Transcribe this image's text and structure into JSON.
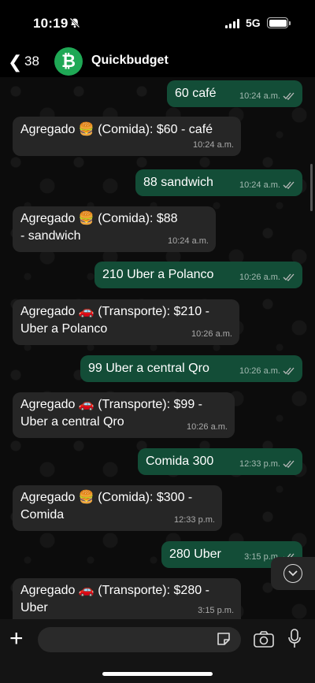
{
  "status_bar": {
    "time": "10:19",
    "network": "5G"
  },
  "header": {
    "back_count": "38",
    "contact_name": "Quickbudget",
    "avatar_letter": "₿"
  },
  "messages": [
    {
      "type": "out",
      "text": "60 café",
      "time": "10:24 a.m."
    },
    {
      "type": "in",
      "text": "Agregado 🍔 (Comida): $60 - café",
      "time": "10:24 a.m."
    },
    {
      "type": "out",
      "text": "88 sandwich",
      "time": "10:24 a.m."
    },
    {
      "type": "in",
      "text": "Agregado 🍔 (Comida): $88 - sandwich",
      "time": "10:24 a.m."
    },
    {
      "type": "out",
      "text": "210 Uber a Polanco",
      "time": "10:26 a.m."
    },
    {
      "type": "in",
      "text": "Agregado 🚗 (Transporte): $210 - Uber a Polanco",
      "time": "10:26 a.m."
    },
    {
      "type": "out",
      "text": "99 Uber a central Qro",
      "time": "10:26 a.m."
    },
    {
      "type": "in",
      "text": "Agregado 🚗 (Transporte): $99 - Uber a central Qro",
      "time": "10:26 a.m."
    },
    {
      "type": "out",
      "text": "Comida 300",
      "time": "12:33 p.m."
    },
    {
      "type": "in",
      "text": "Agregado 🍔 (Comida): $300 - Comida",
      "time": "12:33 p.m."
    },
    {
      "type": "out",
      "text": "280 Uber",
      "time": "3:15 p.m."
    },
    {
      "type": "in",
      "text": "Agregado 🚗 (Transporte): $280 - Uber",
      "time": "3:15 p.m."
    }
  ],
  "colors": {
    "outgoing": "#134d37",
    "incoming": "#262626",
    "avatar": "#1fa855",
    "background": "#0b0b0b"
  }
}
